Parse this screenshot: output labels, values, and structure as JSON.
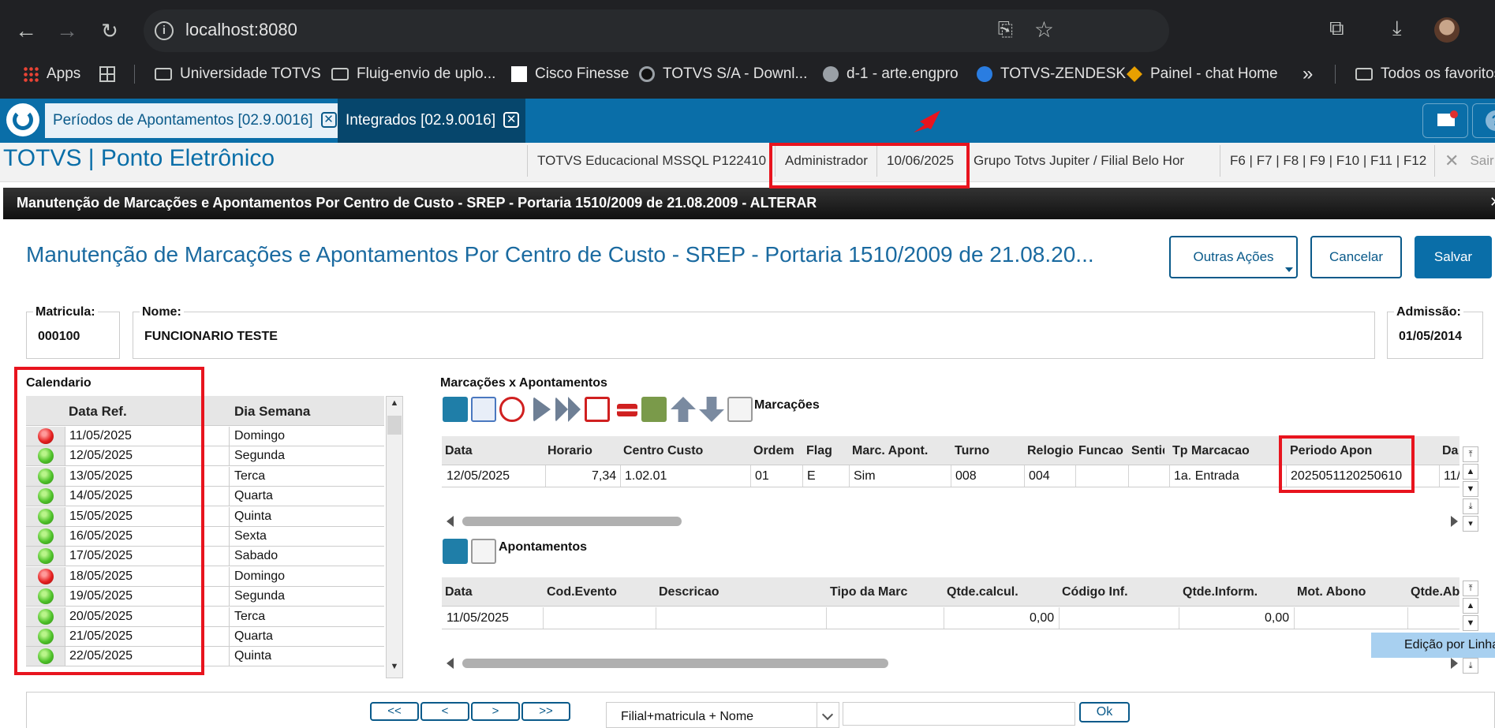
{
  "browser": {
    "url": "localhost:8080",
    "bookmarks": [
      {
        "label": "Apps",
        "icon": "apps-icon"
      },
      {
        "label": "",
        "icon": "grid-icon"
      },
      {
        "label": "Universidade TOTVS",
        "icon": "folder-icon"
      },
      {
        "label": "Fluig-envio de uplo...",
        "icon": "folder-icon"
      },
      {
        "label": "Cisco Finesse",
        "icon": "cisco-icon"
      },
      {
        "label": "TOTVS S/A - Downl...",
        "icon": "totvs-icon"
      },
      {
        "label": "d-1 - arte.engpro",
        "icon": "globe-icon"
      },
      {
        "label": "TOTVS-ZENDESK",
        "icon": "zendesk-icon"
      },
      {
        "label": "Painel - chat Home",
        "icon": "painel-icon"
      },
      {
        "label": "»",
        "icon": "more-icon"
      },
      {
        "label": "Todos os favoritos",
        "icon": "folder-icon"
      }
    ]
  },
  "app": {
    "tabs": [
      {
        "label": "Períodos de Apontamentos [02.9.0016]",
        "close": "✕"
      },
      {
        "label": "Integrados [02.9.0016]",
        "close": "✕"
      }
    ],
    "title": "TOTVS | Ponto Eletrônico",
    "header": {
      "environment": "TOTVS Educacional MSSQL P122410",
      "user": "Administrador",
      "date": "10/06/2025",
      "company": "Grupo Totvs Jupiter / Filial Belo Hor",
      "shortcuts": "F6 | F7 | F8 | F9 | F10 | F11 | F12",
      "exit": "Sair"
    }
  },
  "form": {
    "bar_title": "Manutenção de Marcações e Apontamentos Por Centro de Custo - SREP - Portaria 1510/2009 de 21.08.2009 - ALTERAR",
    "page_title": "Manutenção de Marcações e Apontamentos Por Centro de Custo - SREP - Portaria 1510/2009 de 21.08.20...",
    "buttons": {
      "outras": "Outras Ações",
      "cancelar": "Cancelar",
      "salvar": "Salvar"
    },
    "fields": {
      "matricula": {
        "label": "Matricula:",
        "value": "000100"
      },
      "nome": {
        "label": "Nome:",
        "value": "FUNCIONARIO TESTE"
      },
      "admissao": {
        "label": "Admissão:",
        "value": "01/05/2014"
      }
    }
  },
  "calendar": {
    "title": "Calendario",
    "headers": [
      "Data Ref.",
      "Dia Semana"
    ],
    "rows": [
      {
        "status": "red",
        "date": "11/05/2025",
        "day": "Domingo"
      },
      {
        "status": "green",
        "date": "12/05/2025",
        "day": "Segunda"
      },
      {
        "status": "green",
        "date": "13/05/2025",
        "day": "Terca"
      },
      {
        "status": "green",
        "date": "14/05/2025",
        "day": "Quarta"
      },
      {
        "status": "green",
        "date": "15/05/2025",
        "day": "Quinta"
      },
      {
        "status": "green",
        "date": "16/05/2025",
        "day": "Sexta"
      },
      {
        "status": "green",
        "date": "17/05/2025",
        "day": "Sabado"
      },
      {
        "status": "red",
        "date": "18/05/2025",
        "day": "Domingo"
      },
      {
        "status": "green",
        "date": "19/05/2025",
        "day": "Segunda"
      },
      {
        "status": "green",
        "date": "20/05/2025",
        "day": "Terca"
      },
      {
        "status": "green",
        "date": "21/05/2025",
        "day": "Quarta"
      },
      {
        "status": "green",
        "date": "22/05/2025",
        "day": "Quinta"
      }
    ]
  },
  "marcacoes": {
    "section_title": "Marcações x Apontamentos",
    "toolbar_label": "Marcações",
    "columns": [
      "Data",
      "Horario",
      "Centro Custo",
      "Ordem",
      "Flag",
      "Marc. Apont.",
      "Turno",
      "Relogio",
      "Funcao",
      "Sentid",
      "Tp Marcacao",
      "Periodo Apon",
      "Da"
    ],
    "rows": [
      [
        "12/05/2025",
        "7,34",
        "1.02.01",
        "01",
        "E",
        "Sim",
        "008",
        "004",
        "",
        "",
        "1a. Entrada",
        "2025051120250610",
        "11/"
      ]
    ]
  },
  "apontamentos": {
    "toolbar_label": "Apontamentos",
    "columns": [
      "Data",
      "Cod.Evento",
      "Descricao",
      "Tipo da Marc",
      "Qtde.calcul.",
      "Código Inf.",
      "Qtde.Inform.",
      "Mot. Abono",
      "Qtde.Ab"
    ],
    "rows": [
      [
        "11/05/2025",
        "",
        "",
        "",
        "0,00",
        "",
        "0,00",
        "",
        ""
      ]
    ],
    "edit_mode": "Edição por Linha"
  },
  "bottom": {
    "pager": [
      "<<",
      "<",
      ">",
      ">>"
    ],
    "search_by": "Filial+matricula + Nome",
    "search_value": "",
    "ok": "Ok"
  },
  "colors": {
    "brand_blue": "#0a6ea8",
    "annotation_red": "#e8141e",
    "status_green": "#4fc22a",
    "status_red": "#e52020"
  }
}
